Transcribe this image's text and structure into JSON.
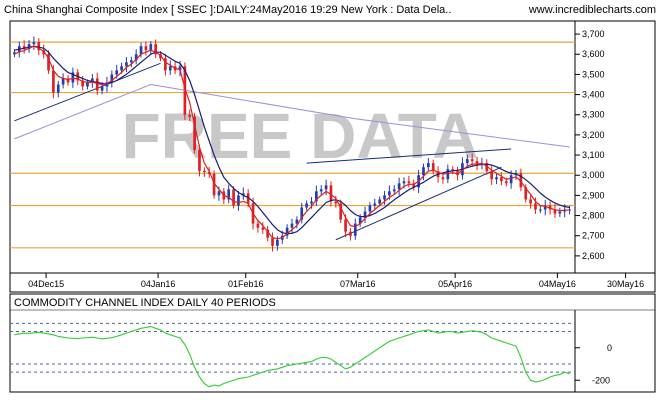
{
  "header": {
    "title": "China Shanghai Composite Index [ SSEC ]:DAILY:24May2016 19:29 New York : Data Dela..",
    "brand": "www.incrediblecharts.com",
    "watermark": "FREE DATA"
  },
  "colors": {
    "up": "#1f3fae",
    "down": "#e02020",
    "sma_fast": "#e02020",
    "sma_slow": "#1a1a7a",
    "sma_long": "#9a90d8",
    "hline": "#e8a640",
    "trendline": "#1a2a7a",
    "cci_line": "#33cc33",
    "cci_levels": "#556699",
    "border": "#000000"
  },
  "chart_data": [
    {
      "type": "candlestick",
      "title": "China Shanghai Composite Index [ SSEC ]:DAILY:24May2016 19:29 New York : Data Dela..",
      "xlabel": "",
      "ylabel": "",
      "ylim": [
        2530,
        3750
      ],
      "grid": false,
      "x_tick_labels": [
        "04Dec15",
        "04Jan16",
        "01Feb16",
        "07Mar16",
        "05Apr16",
        "04May16",
        "30May16"
      ],
      "y_tick_labels": [
        "2,600",
        "2,700",
        "2,800",
        "2,900",
        "3,000",
        "3,100",
        "3,200",
        "3,300",
        "3,400",
        "3,500",
        "3,600",
        "3,700"
      ],
      "y_tick_values": [
        2600,
        2700,
        2800,
        2900,
        3000,
        3100,
        3200,
        3300,
        3400,
        3500,
        3600,
        3700
      ],
      "horizontal_lines": [
        3660,
        3410,
        3010,
        2850,
        2640
      ],
      "close": [
        3610,
        3640,
        3625,
        3650,
        3660,
        3620,
        3600,
        3520,
        3410,
        3450,
        3480,
        3460,
        3510,
        3470,
        3440,
        3460,
        3480,
        3420,
        3440,
        3460,
        3500,
        3520,
        3540,
        3560,
        3570,
        3600,
        3640,
        3620,
        3650,
        3600,
        3580,
        3520,
        3540,
        3520,
        3540,
        3300,
        3290,
        3125,
        3022,
        3016,
        3007,
        2900,
        2920,
        2880,
        2930,
        2850,
        2900,
        2910,
        2860,
        2760,
        2740,
        2730,
        2690,
        2650,
        2680,
        2700,
        2740,
        2760,
        2780,
        2840,
        2860,
        2870,
        2920,
        2930,
        2950,
        2870,
        2860,
        2780,
        2720,
        2700,
        2760,
        2790,
        2820,
        2850,
        2860,
        2880,
        2900,
        2920,
        2930,
        2960,
        2970,
        2960,
        2940,
        3000,
        3040,
        3060,
        3020,
        2990,
        2980,
        3030,
        3020,
        3000,
        3060,
        3080,
        3070,
        3050,
        3060,
        3020,
        2980,
        2990,
        2970,
        2960,
        3000,
        3010,
        2940,
        2880,
        2860,
        2830,
        2830,
        2850,
        2830,
        2810,
        2820,
        2830,
        2830
      ],
      "sma_fast": [
        3600,
        3612,
        3618,
        3630,
        3640,
        3630,
        3615,
        3580,
        3520,
        3490,
        3480,
        3475,
        3480,
        3478,
        3465,
        3460,
        3462,
        3455,
        3450,
        3455,
        3470,
        3490,
        3510,
        3535,
        3550,
        3575,
        3600,
        3610,
        3620,
        3610,
        3595,
        3560,
        3545,
        3530,
        3525,
        3430,
        3360,
        3250,
        3140,
        3060,
        3020,
        2960,
        2930,
        2900,
        2890,
        2870,
        2865,
        2870,
        2860,
        2810,
        2775,
        2750,
        2720,
        2690,
        2685,
        2690,
        2710,
        2730,
        2750,
        2790,
        2820,
        2845,
        2880,
        2900,
        2920,
        2905,
        2885,
        2840,
        2790,
        2750,
        2745,
        2760,
        2785,
        2810,
        2830,
        2850,
        2870,
        2890,
        2905,
        2925,
        2945,
        2955,
        2955,
        2970,
        2995,
        3020,
        3025,
        3015,
        3005,
        3010,
        3012,
        3008,
        3025,
        3045,
        3055,
        3055,
        3058,
        3045,
        3025,
        3010,
        2995,
        2980,
        2985,
        2992,
        2970,
        2935,
        2905,
        2870,
        2850,
        2845,
        2838,
        2828,
        2825,
        2826,
        2828
      ],
      "sma_slow": [
        3620,
        3625,
        3630,
        3635,
        3640,
        3635,
        3630,
        3610,
        3580,
        3555,
        3530,
        3510,
        3500,
        3490,
        3480,
        3470,
        3465,
        3460,
        3455,
        3455,
        3460,
        3470,
        3485,
        3500,
        3520,
        3540,
        3560,
        3580,
        3600,
        3610,
        3610,
        3595,
        3580,
        3565,
        3555,
        3520,
        3470,
        3400,
        3320,
        3240,
        3170,
        3100,
        3040,
        2990,
        2960,
        2935,
        2915,
        2900,
        2890,
        2870,
        2845,
        2815,
        2785,
        2755,
        2730,
        2715,
        2710,
        2712,
        2720,
        2740,
        2765,
        2790,
        2815,
        2840,
        2865,
        2875,
        2878,
        2870,
        2850,
        2825,
        2805,
        2795,
        2795,
        2800,
        2810,
        2825,
        2840,
        2860,
        2878,
        2895,
        2912,
        2928,
        2940,
        2952,
        2965,
        2980,
        2995,
        3005,
        3012,
        3018,
        3022,
        3024,
        3030,
        3038,
        3045,
        3050,
        3054,
        3055,
        3050,
        3042,
        3030,
        3018,
        3010,
        3005,
        2995,
        2978,
        2958,
        2935,
        2912,
        2892,
        2876,
        2862,
        2852,
        2845,
        2840
      ],
      "sma_long": [
        3180,
        3450,
        3280,
        3140
      ],
      "sma_long_x_index": [
        0,
        28,
        70,
        114
      ]
    },
    {
      "type": "line",
      "title": "COMMODITY CHANNEL INDEX DAILY 40 PERIODS",
      "xlabel": "",
      "ylabel": "",
      "ylim": [
        -260,
        220
      ],
      "grid": false,
      "y_tick_labels": [
        "0",
        "-200"
      ],
      "y_tick_values": [
        0,
        -200
      ],
      "levels": [
        150,
        100,
        -100,
        -150
      ],
      "values": [
        80,
        85,
        90,
        88,
        92,
        95,
        90,
        85,
        80,
        70,
        65,
        60,
        58,
        56,
        60,
        62,
        65,
        60,
        55,
        58,
        62,
        70,
        80,
        90,
        100,
        110,
        120,
        125,
        130,
        120,
        110,
        90,
        80,
        70,
        60,
        20,
        -40,
        -120,
        -180,
        -220,
        -240,
        -230,
        -235,
        -220,
        -210,
        -200,
        -190,
        -185,
        -180,
        -170,
        -160,
        -150,
        -140,
        -135,
        -130,
        -120,
        -110,
        -105,
        -100,
        -95,
        -90,
        -85,
        -70,
        -60,
        -60,
        -70,
        -90,
        -110,
        -130,
        -120,
        -100,
        -80,
        -60,
        -40,
        -20,
        0,
        20,
        40,
        50,
        60,
        70,
        80,
        90,
        100,
        105,
        110,
        100,
        90,
        95,
        100,
        98,
        90,
        95,
        100,
        105,
        100,
        95,
        80,
        60,
        50,
        40,
        30,
        20,
        10,
        -60,
        -150,
        -200,
        -210,
        -205,
        -195,
        -180,
        -170,
        -165,
        -150,
        -160
      ]
    }
  ]
}
